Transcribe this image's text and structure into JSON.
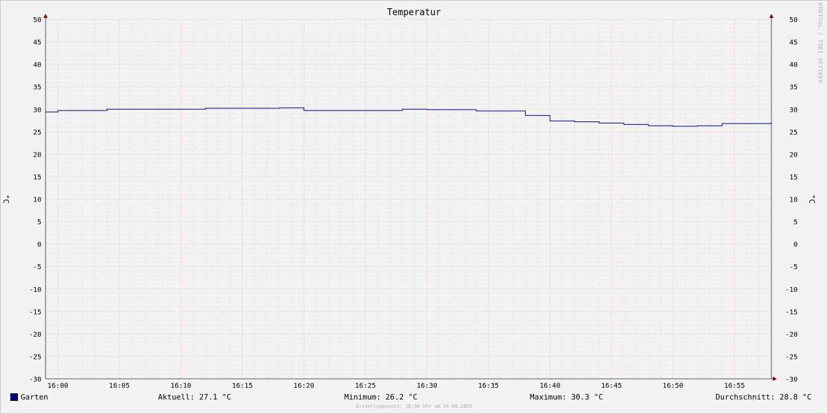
{
  "chart_data": {
    "type": "line",
    "title": "Temperatur",
    "ylabel": "°C",
    "ylabel_right": "°C",
    "ylim": [
      -30,
      50
    ],
    "y_ticks": [
      "50",
      "45",
      "40",
      "35",
      "30",
      "25",
      "20",
      "15",
      "10",
      "5",
      "0",
      "-5",
      "-10",
      "-15",
      "-20",
      "-25",
      "-30"
    ],
    "x_ticks": [
      "16:00",
      "16:05",
      "16:10",
      "16:15",
      "16:20",
      "16:25",
      "16:30",
      "16:35",
      "16:40",
      "16:45",
      "16:50",
      "16:55"
    ],
    "x_tick_minutes": [
      0,
      5,
      10,
      15,
      20,
      25,
      30,
      35,
      40,
      45,
      50,
      55
    ],
    "xlim_minutes": [
      -1,
      58
    ],
    "grid": true,
    "legend_position": "bottom-left",
    "series": [
      {
        "name": "Garten",
        "color": "#00008b",
        "step_minutes": [
          -1,
          0,
          4,
          10,
          12,
          18,
          20,
          28,
          30,
          34,
          38,
          40,
          42,
          44,
          46,
          48,
          50,
          52,
          54,
          56,
          58
        ],
        "values": [
          29.4,
          29.7,
          30.0,
          30.0,
          30.2,
          30.3,
          29.7,
          30.0,
          29.9,
          29.6,
          28.6,
          27.4,
          27.2,
          26.9,
          26.6,
          26.3,
          26.2,
          26.3,
          26.8,
          26.8,
          27.1
        ]
      }
    ]
  },
  "legend": {
    "series_name": "Garten",
    "current": "Aktuell: 27.1 °C",
    "minimum": "Minimum: 26.2 °C",
    "maximum": "Maximum: 30.3 °C",
    "average": "Durchschnitt: 28.8 °C"
  },
  "footer": "Erstellungszeit: 16:58 Uhr am 10.08.2025",
  "watermark": "RRDTOOL / TOBI OETIKER"
}
